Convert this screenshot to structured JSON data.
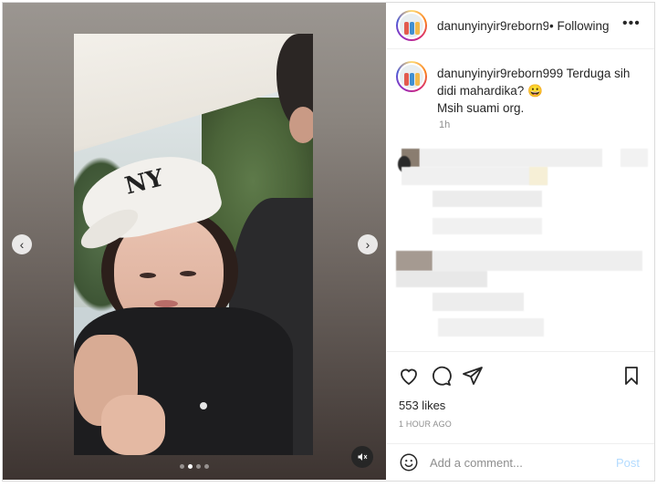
{
  "post": {
    "username": "danunyinyir9reborn999",
    "follow_separator": "•",
    "follow_status": "Following",
    "more_label": "•••",
    "caption_user": "danunyinyir9reborn999",
    "caption_line1": "Terduga sih didi mahardika? 😀",
    "caption_line2": "Msih suami org.",
    "caption_time": "1h",
    "likes": "553 likes",
    "posted_ago": "1 HOUR AGO"
  },
  "carousel": {
    "prev_icon": "chevron-left-icon",
    "next_icon": "chevron-right-icon",
    "prev_glyph": "‹",
    "next_glyph": "›",
    "slide_count": 4,
    "active_index": 1,
    "mute_icon": "speaker-muted-icon",
    "logo_text": "NY"
  },
  "actions": {
    "like_icon": "heart-icon",
    "comment_icon": "comment-bubble-icon",
    "share_icon": "paper-plane-icon",
    "save_icon": "bookmark-icon"
  },
  "comment_box": {
    "emoji_icon": "emoji-smile-icon",
    "placeholder": "Add a comment...",
    "post_label": "Post"
  },
  "colors": {
    "accent_disabled": "#b3dbff",
    "text_primary": "#262626",
    "text_secondary": "#8e8e8e",
    "border": "#efefef"
  }
}
